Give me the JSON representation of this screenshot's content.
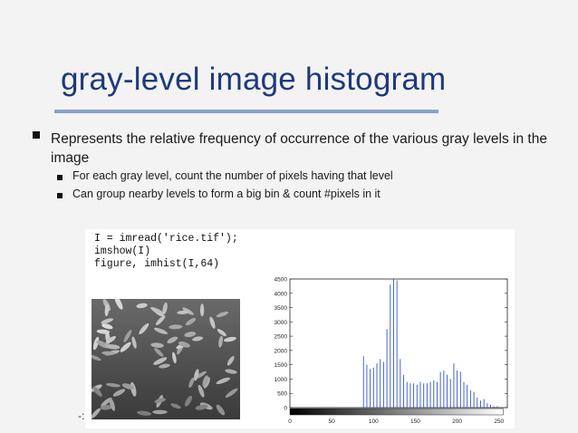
{
  "slide": {
    "title": "gray-level image histogram",
    "bullet_main": "Represents the relative frequency of occurrence of the various gray levels in the image",
    "bullets_sub": [
      "For each gray level, count the number of pixels having that level",
      "Can group nearby levels to form a big bin & count #pixels in it"
    ],
    "page_marker": "-:"
  },
  "code": {
    "lines": [
      "I = imread('rice.tif');",
      "imshow(I)",
      "figure, imhist(I,64)"
    ]
  },
  "chart_data": {
    "type": "bar",
    "title": "",
    "xlabel": "",
    "ylabel": "",
    "xlim": [
      0,
      260
    ],
    "ylim": [
      0,
      4500
    ],
    "xticks": [
      0,
      50,
      100,
      150,
      200,
      250
    ],
    "yticks": [
      0,
      500,
      1000,
      1500,
      2000,
      2500,
      3000,
      3500,
      4000,
      4500
    ],
    "x": [
      0,
      4,
      8,
      12,
      16,
      20,
      24,
      28,
      32,
      36,
      40,
      44,
      48,
      52,
      56,
      60,
      64,
      68,
      72,
      76,
      80,
      84,
      88,
      92,
      96,
      100,
      104,
      108,
      112,
      116,
      120,
      124,
      128,
      132,
      136,
      140,
      144,
      148,
      152,
      156,
      160,
      164,
      168,
      172,
      176,
      180,
      184,
      188,
      192,
      196,
      200,
      204,
      208,
      212,
      216,
      220,
      224,
      228,
      232,
      236,
      240,
      244,
      248,
      252
    ],
    "values": [
      0,
      0,
      0,
      0,
      0,
      0,
      0,
      0,
      0,
      0,
      0,
      0,
      0,
      0,
      0,
      0,
      0,
      0,
      0,
      0,
      0,
      0,
      1800,
      1500,
      1350,
      1400,
      1550,
      1700,
      1600,
      2750,
      4300,
      4500,
      4450,
      1700,
      1150,
      900,
      850,
      850,
      800,
      900,
      850,
      850,
      900,
      950,
      900,
      1250,
      1300,
      1150,
      1000,
      1550,
      1300,
      1250,
      900,
      800,
      600,
      550,
      350,
      250,
      300,
      150,
      100,
      50,
      50,
      0
    ],
    "grid": false,
    "legend": "none"
  }
}
